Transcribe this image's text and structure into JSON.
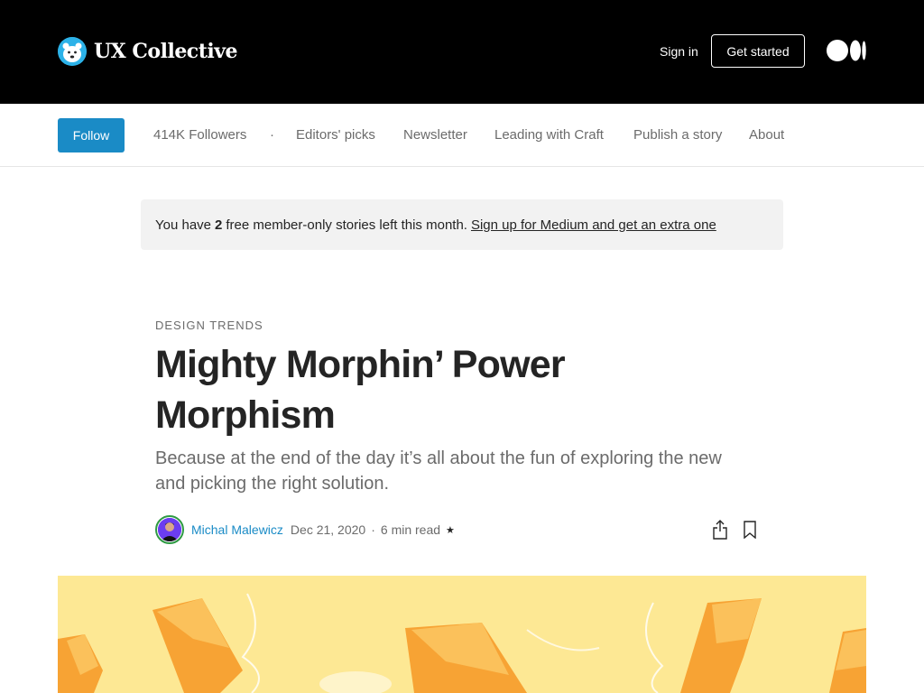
{
  "header": {
    "brand": "UX Collective",
    "signin": "Sign in",
    "get_started": "Get started",
    "logo_icon": "polar-bear-icon",
    "medium_icon": "medium-logo-icon"
  },
  "pubnav": {
    "follow": "Follow",
    "followers": "414K Followers",
    "dot": "·",
    "links": [
      "Editors' picks",
      "Newsletter",
      "Leading with Craft",
      "Publish a story",
      "About"
    ]
  },
  "banner": {
    "prefix": "You have",
    "count": "2",
    "suffix": "free member-only stories left this month.",
    "link": "Sign up for Medium and get an extra one"
  },
  "article": {
    "kicker": "Design Trends",
    "title": "Mighty Morphin’ Power Morphism",
    "subtitle": "Because at the end of the day it’s all about the fun of exploring the new and picking the right solution.",
    "author": "Michal Malewicz",
    "date": "Dec 21, 2020",
    "separator": "·",
    "read_time": "6 min read",
    "member_star": "★"
  },
  "colors": {
    "accent": "#1a8bc6",
    "header_bg": "#000000",
    "hero_bg": "#fde894",
    "bolt": "#f7a334"
  }
}
